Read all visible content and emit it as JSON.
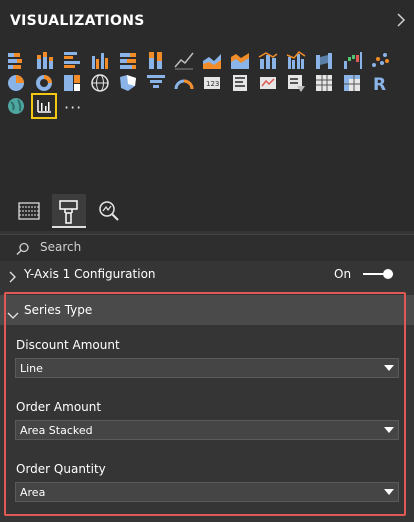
{
  "pane": {
    "title": "VISUALIZATIONS"
  },
  "gallery": {
    "icons": [
      "stacked-bar-chart-icon",
      "stacked-column-chart-icon",
      "clustered-bar-chart-icon",
      "clustered-column-chart-icon",
      "100-stacked-bar-chart-icon",
      "100-stacked-column-chart-icon",
      "line-chart-icon",
      "area-chart-icon",
      "stacked-area-chart-icon",
      "line-and-stacked-column-chart-icon",
      "line-and-clustered-column-chart-icon",
      "ribbon-chart-icon",
      "waterfall-chart-icon",
      "scatter-chart-icon",
      "pie-chart-icon",
      "donut-chart-icon",
      "treemap-icon",
      "map-icon",
      "filled-map-icon",
      "funnel-chart-icon",
      "gauge-icon",
      "card-icon",
      "multi-row-card-icon",
      "kpi-icon",
      "slicer-icon",
      "table-icon",
      "matrix-icon",
      "r-script-visual-icon",
      "globe-map-icon",
      "custom-visual-icon",
      "more-visuals-icon"
    ],
    "more_label": "···"
  },
  "tabs": [
    "fields-tab-icon",
    "format-paint-roller-icon",
    "analytics-magnifier-icon"
  ],
  "search": {
    "placeholder": "Search"
  },
  "y_axis": {
    "label": "Y-Axis 1 Configuration",
    "toggle_label": "On",
    "toggle_on": true
  },
  "series_type": {
    "label": "Series Type",
    "fields": [
      {
        "label": "Discount Amount",
        "value": "Line"
      },
      {
        "label": "Order Amount",
        "value": "Area Stacked"
      },
      {
        "label": "Order Quantity",
        "value": "Area"
      }
    ]
  },
  "colors": {
    "accent_selected": "#f2c811",
    "highlight_border": "#e05a55",
    "panel_bg": "#353535"
  }
}
